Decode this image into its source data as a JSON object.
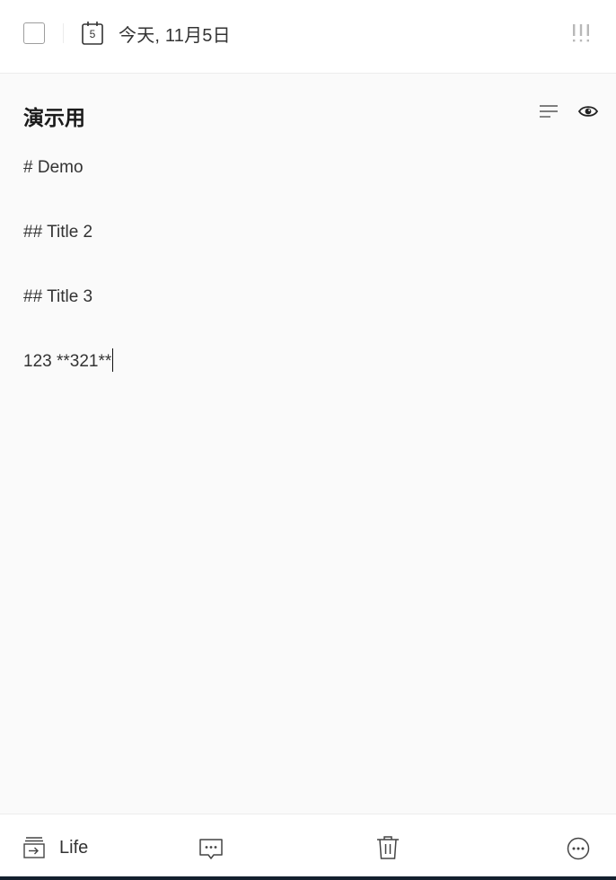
{
  "header": {
    "checkbox_checked": false,
    "calendar_day": "5",
    "date_label": "今天, 11月5日",
    "priority_icon": "priority-icon"
  },
  "note": {
    "title": "演示用",
    "outline_icon": "outline-icon",
    "preview_icon": "eye-icon"
  },
  "editor": {
    "lines": [
      "# Demo",
      "## Title 2",
      "## Title 3",
      "123 **321**"
    ]
  },
  "footer": {
    "list_name": "Life",
    "list_icon": "move-to-list-icon",
    "comment_icon": "comment-icon",
    "delete_icon": "trash-icon",
    "more_icon": "more-icon"
  },
  "colors": {
    "background": "#fafafa",
    "bar": "#ffffff",
    "text": "#333333",
    "title": "#1a1a1a",
    "divider": "#ececec",
    "bottom_strip": "#14202e"
  }
}
